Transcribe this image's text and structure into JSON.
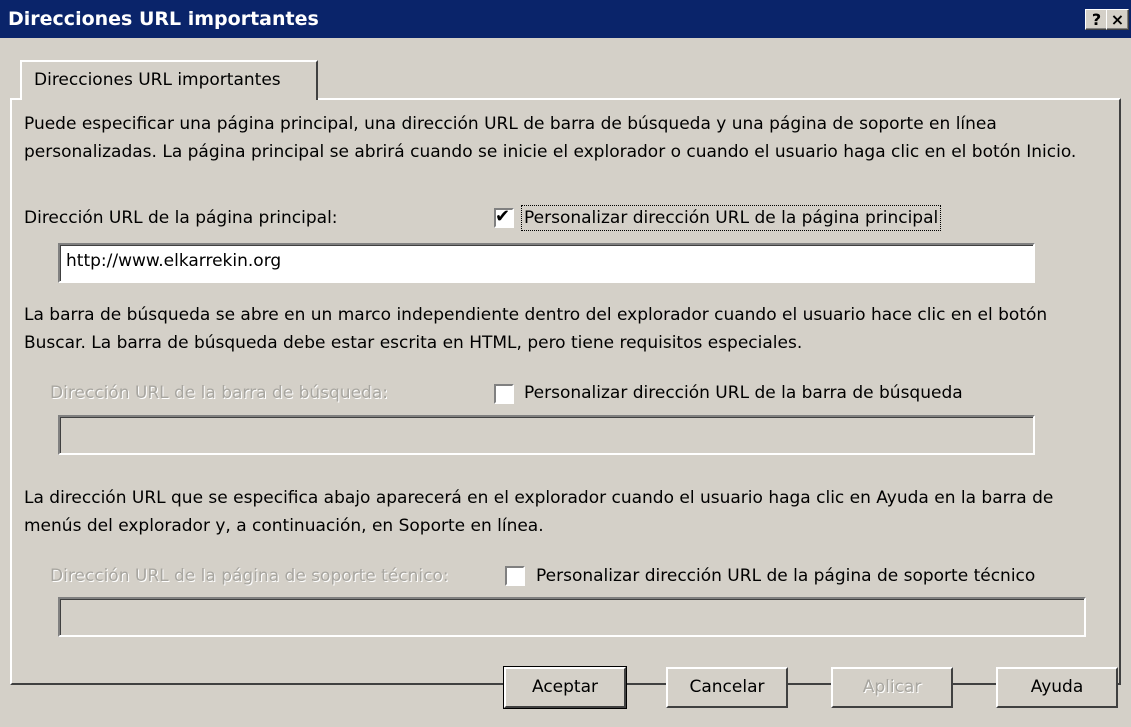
{
  "window": {
    "title": "Direcciones URL importantes",
    "help_button": "?",
    "close_button": "×"
  },
  "tab": {
    "label": "Direcciones URL importantes"
  },
  "home": {
    "description": "Puede especificar una página principal, una dirección URL de barra de búsqueda y una página de soporte en línea personalizadas. La página principal se abrirá cuando se inicie el explorador o cuando el usuario haga clic en el botón Inicio.",
    "label": "Dirección URL de la página principal:",
    "checkbox_label": "Personalizar dirección URL de la página principal",
    "checked": true,
    "url_value": "http://www.elkarrekin.org"
  },
  "search": {
    "description": "La barra de búsqueda se abre en un marco independiente dentro del explorador cuando el usuario hace clic en el botón Buscar. La barra de búsqueda debe estar escrita en HTML, pero tiene requisitos especiales.",
    "label": "Dirección URL de la barra de búsqueda:",
    "checkbox_label": "Personalizar dirección URL de la barra de búsqueda",
    "checked": false,
    "url_value": ""
  },
  "support": {
    "description": "La dirección URL que se especifica abajo aparecerá en el explorador cuando el usuario haga clic en Ayuda en la barra de menús del explorador y, a continuación, en Soporte en línea.",
    "label": "Dirección URL de la página de soporte técnico:",
    "checkbox_label": "Personalizar dirección URL de la página de soporte técnico",
    "checked": false,
    "url_value": ""
  },
  "buttons": {
    "accept": "Aceptar",
    "cancel": "Cancelar",
    "apply": "Aplicar",
    "help": "Ayuda"
  }
}
